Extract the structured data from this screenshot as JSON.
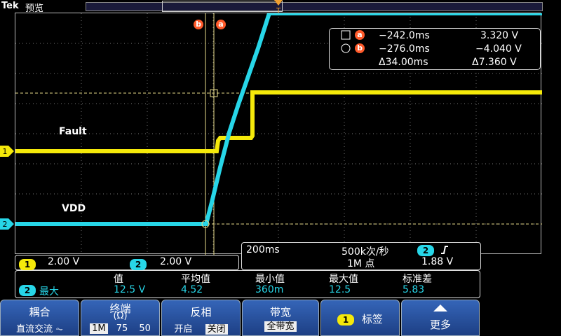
{
  "top": {
    "brand": "Tek",
    "mode": "预览"
  },
  "markers": {
    "trigger": "T",
    "ch1": "1",
    "ch2": "2",
    "cursor_b": "b",
    "cursor_a": "a"
  },
  "trace_labels": {
    "fault": "Fault",
    "vdd": "VDD"
  },
  "cursor_readout": {
    "a_time": "−242.0ms",
    "a_volt": "3.320 V",
    "b_time": "−276.0ms",
    "b_volt": "−4.040 V",
    "delta_time": "Δ34.00ms",
    "delta_volt": "Δ7.360 V"
  },
  "channels": {
    "ch1_num": "1",
    "ch1_scale": "2.00 V",
    "ch2_num": "2",
    "ch2_scale": "2.00 V"
  },
  "acquisition": {
    "timebase": "200ms",
    "sample_rate": "500k次/秒",
    "record_length": "1M 点",
    "trigger_source": "2",
    "trigger_level": "1.88 V"
  },
  "measurement": {
    "headers": [
      "值",
      "平均值",
      "最小值",
      "最大值",
      "标准差"
    ],
    "channel": "2",
    "name": "最大",
    "values": [
      "12.5 V",
      "4.52",
      "360m",
      "12.5",
      "5.83"
    ]
  },
  "menu": {
    "coupling": {
      "title": "耦合",
      "sub": "直流交流 ⏦"
    },
    "termination": {
      "title": "终端",
      "title2": "(Ω)",
      "opt1": "1M",
      "opt2": "75",
      "opt3": "50"
    },
    "invert": {
      "title": "反相",
      "on": "开启",
      "off": "关闭"
    },
    "bandwidth": {
      "title": "带宽",
      "sub": "全带宽"
    },
    "label": {
      "num": "1",
      "title": "标签"
    },
    "more": {
      "title": "更多"
    }
  },
  "colors": {
    "ch1": "#f5e90a",
    "ch2": "#27d6e8",
    "cursor": "#ff5a2a",
    "menu": "#2a54a8"
  }
}
